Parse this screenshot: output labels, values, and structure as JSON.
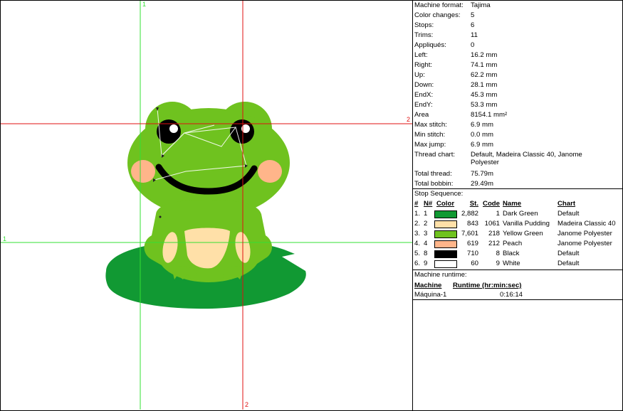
{
  "design": {
    "guide_labels": {
      "green_top": "1",
      "green_left": "1",
      "red_right": "2",
      "red_bottom": "2"
    },
    "colors": {
      "guide_green": "#33e033",
      "guide_red": "#e01010",
      "dark_green": "#119933",
      "vanilla": "#ffe0a8",
      "yellow_green": "#6fc21f",
      "peach": "#ffb58a",
      "black": "#000000",
      "white": "#ffffff"
    }
  },
  "summary": {
    "rows": [
      {
        "label": "Machine format:",
        "value": "Tajima"
      },
      {
        "label": "Color changes:",
        "value": "5"
      },
      {
        "label": "Stops:",
        "value": "6"
      },
      {
        "label": "Trims:",
        "value": "11"
      },
      {
        "label": "Appliqués:",
        "value": "0"
      },
      {
        "label": "Left:",
        "value": "16.2 mm"
      },
      {
        "label": "Right:",
        "value": "74.1 mm"
      },
      {
        "label": "Up:",
        "value": "62.2 mm"
      },
      {
        "label": "Down:",
        "value": "28.1 mm"
      },
      {
        "label": "EndX:",
        "value": "45.3 mm"
      },
      {
        "label": "EndY:",
        "value": "53.3 mm"
      },
      {
        "label": "Area",
        "value": "8154.1 mm²"
      },
      {
        "label": "Max stitch:",
        "value": "6.9 mm"
      },
      {
        "label": "Min stitch:",
        "value": "0.0 mm"
      },
      {
        "label": "Max jump:",
        "value": "6.9 mm"
      }
    ],
    "thread_chart": {
      "label": "Thread chart:",
      "value_line1": "Default, Madeira Classic 40, Janome",
      "value_line2": "Polyester"
    },
    "total_thread": {
      "label": "Total thread:",
      "value": "75.79m"
    },
    "total_bobbin": {
      "label": "Total bobbin:",
      "value": "29.49m"
    }
  },
  "stop_sequence": {
    "title": "Stop Sequence:",
    "headers": {
      "idx": "#",
      "nnum": "N#",
      "color": "Color",
      "st": "St.",
      "code": "Code",
      "name": "Name",
      "chart": "Chart"
    },
    "rows": [
      {
        "idx": "1.",
        "nnum": "1",
        "color": "#119933",
        "st": "2,882",
        "code": "1",
        "name": "Dark Green",
        "chart": "Default"
      },
      {
        "idx": "2.",
        "nnum": "2",
        "color": "#ffe0a8",
        "st": "843",
        "code": "1061",
        "name": "Vanilla Pudding",
        "chart": "Madeira Classic 40"
      },
      {
        "idx": "3.",
        "nnum": "3",
        "color": "#6fc21f",
        "st": "7,601",
        "code": "218",
        "name": "Yellow Green",
        "chart": "Janome Polyester"
      },
      {
        "idx": "4.",
        "nnum": "4",
        "color": "#ffb58a",
        "st": "619",
        "code": "212",
        "name": "Peach",
        "chart": "Janome Polyester"
      },
      {
        "idx": "5.",
        "nnum": "8",
        "color": "#000000",
        "st": "710",
        "code": "8",
        "name": "Black",
        "chart": "Default"
      },
      {
        "idx": "6.",
        "nnum": "9",
        "color": "#ffffff",
        "st": "60",
        "code": "9",
        "name": "White",
        "chart": "Default"
      }
    ]
  },
  "runtime": {
    "title": "Machine runtime:",
    "headers": {
      "machine": "Machine",
      "runtime": "Runtime (hr:min:sec)"
    },
    "rows": [
      {
        "machine": "Máquina-1",
        "runtime": "0:16:14"
      }
    ]
  }
}
